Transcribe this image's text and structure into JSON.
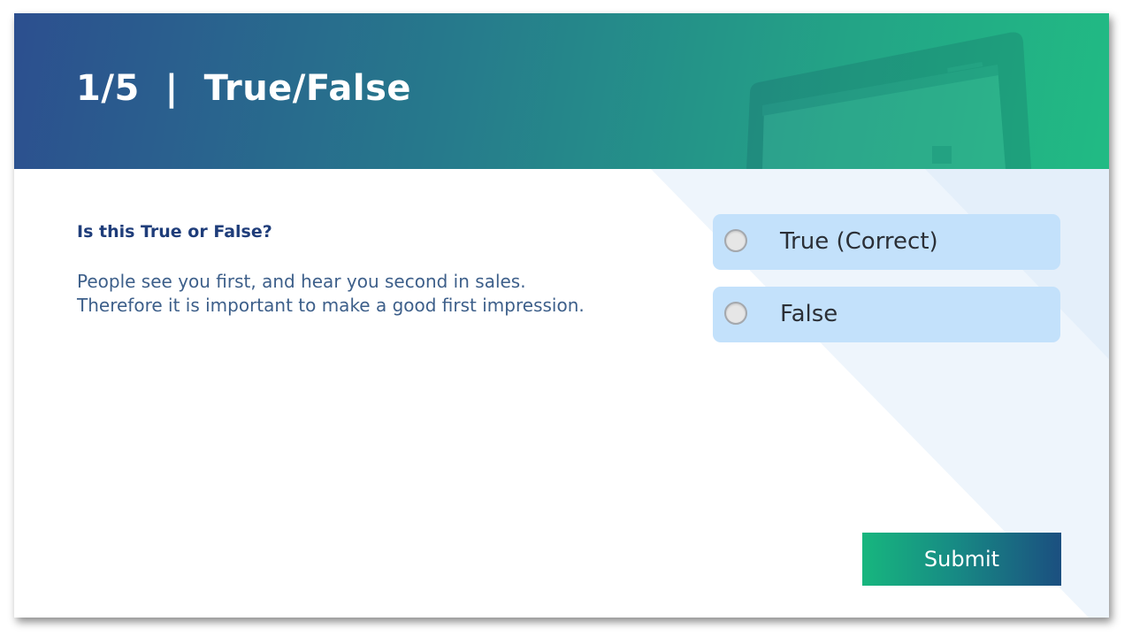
{
  "header": {
    "title": "1/5  |  True/False"
  },
  "question": {
    "heading": "Is this True or False?",
    "body": "People see you first, and hear you second in sales. Therefore it is important to make a good first impression."
  },
  "options": [
    {
      "label": "True (Correct)",
      "selected": false
    },
    {
      "label": "False",
      "selected": false
    }
  ],
  "submit": {
    "label": "Submit"
  },
  "colors": {
    "header_gradient_start": "#2c4f8f",
    "header_gradient_end": "#21bb84",
    "heading_text": "#1f3d7a",
    "body_text": "#3d5f8a",
    "option_background": "#c3e1fb",
    "submit_gradient_start": "#17b67e",
    "submit_gradient_end": "#1b4f80"
  },
  "icons": {
    "header_background": "laptop-icon",
    "option_marker": "radio-button-icon"
  }
}
